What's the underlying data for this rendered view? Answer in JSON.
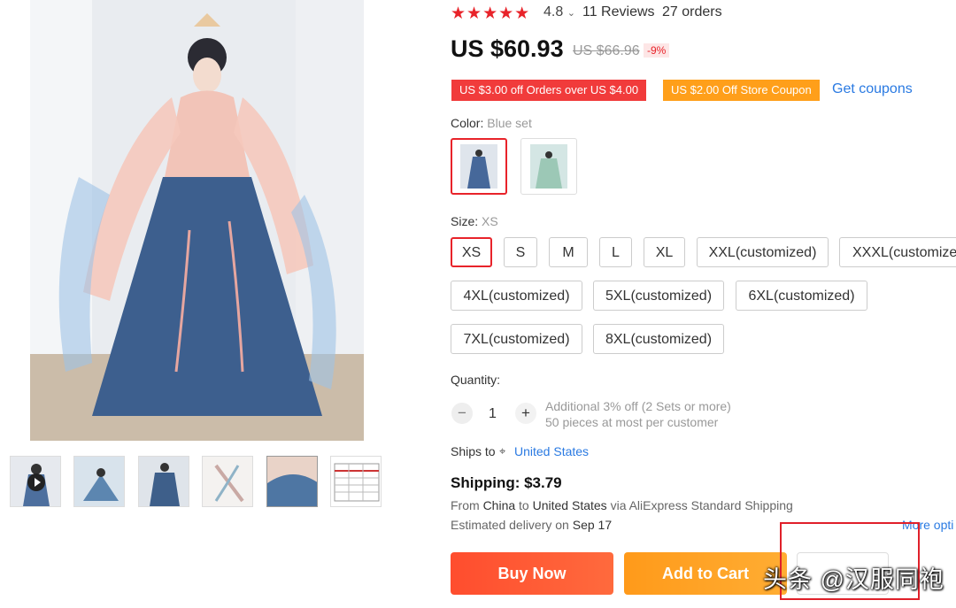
{
  "rating": {
    "stars": "★★★★★",
    "value": "4.8",
    "reviews": "11 Reviews",
    "orders": "27 orders"
  },
  "price": {
    "current": "US $60.93",
    "original": "US $66.96",
    "discount": "-9%"
  },
  "coupons": {
    "orders_coupon": "US $3.00 off Orders over US $4.00",
    "store_coupon": "US $2.00 Off Store Coupon",
    "get_coupons": "Get coupons"
  },
  "color": {
    "label": "Color:",
    "selected": "Blue set"
  },
  "size": {
    "label": "Size:",
    "selected": "XS",
    "options": [
      "XS",
      "S",
      "M",
      "L",
      "XL",
      "XXL(customized)",
      "XXXL(customized)",
      "4XL(customized)",
      "5XL(customized)",
      "6XL(customized)",
      "7XL(customized)",
      "8XL(customized)"
    ]
  },
  "quantity": {
    "label": "Quantity:",
    "minus": "−",
    "value": "1",
    "plus": "+",
    "note1": "Additional 3% off (2 Sets or more)",
    "note2": "50 pieces at most per customer"
  },
  "shipping": {
    "ships_to_label": "Ships to",
    "pin_icon": "📍",
    "country": "United States",
    "title": "Shipping: $3.79",
    "from_prefix": "From",
    "from": "China",
    "to_prefix": "to",
    "to": "United States",
    "via": "via AliExpress Standard Shipping",
    "est_prefix": "Estimated delivery on",
    "est_date": "Sep 17",
    "more_options": "More opti"
  },
  "actions": {
    "buy_now": "Buy Now",
    "add_to_cart": "Add to Cart"
  },
  "watermark": "头条 @汉服同袍",
  "colors": {
    "accent_red": "#e8232a",
    "link_blue": "#2a7ae2",
    "buy_orange": "#ff5733",
    "cart_orange": "#ffa01f"
  }
}
